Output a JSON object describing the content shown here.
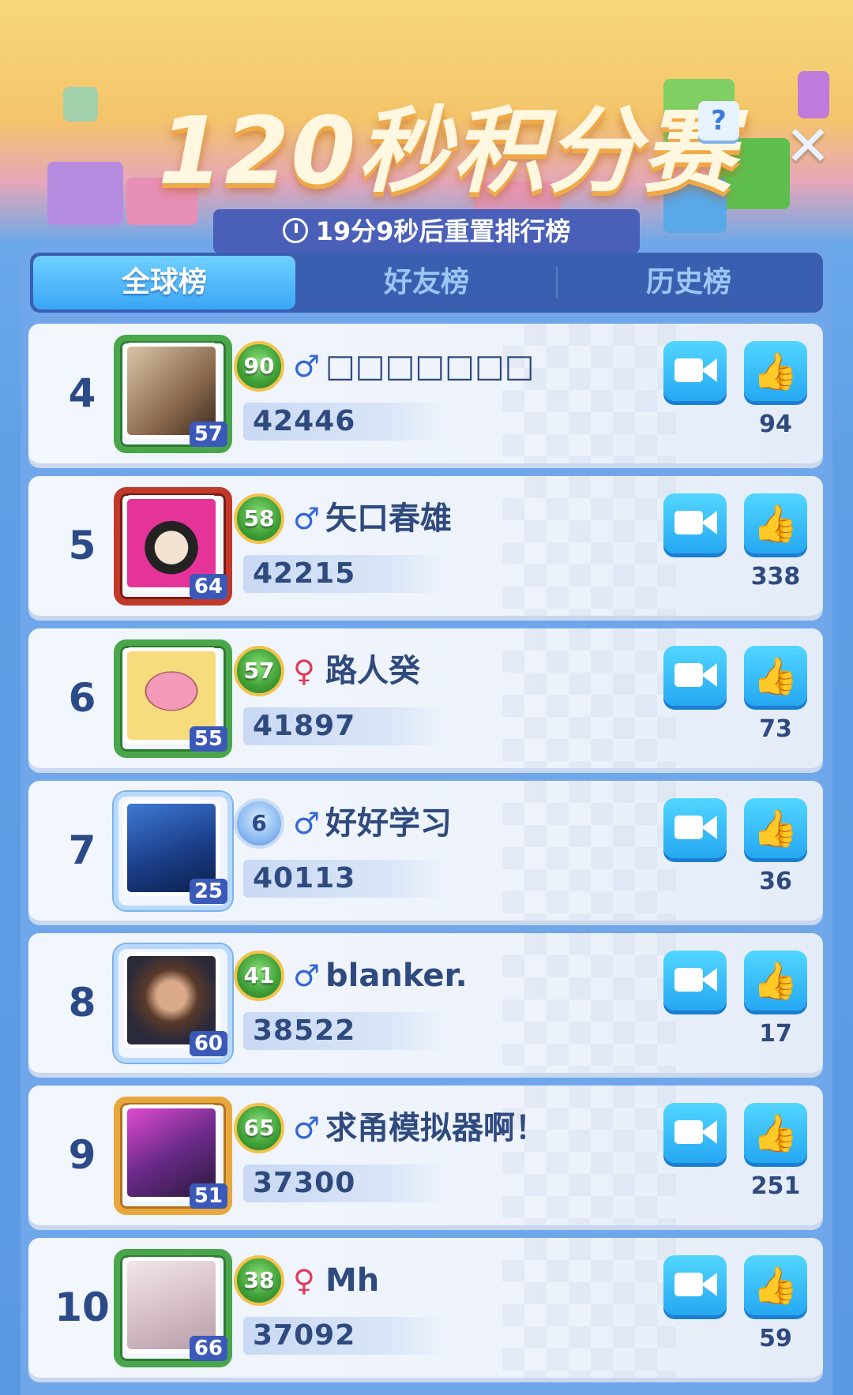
{
  "header": {
    "title": "120秒积分赛",
    "help_label": "?",
    "close_label": "✕",
    "reset_text": "19分9秒后重置排行榜"
  },
  "tabs": [
    {
      "label": "全球榜",
      "active": true
    },
    {
      "label": "好友榜",
      "active": false
    },
    {
      "label": "历史榜",
      "active": false
    }
  ],
  "rows": [
    {
      "rank": "4",
      "level": "90",
      "gender": "♂",
      "name": "□□□□□□□",
      "score": "42446",
      "avatar_level": "57",
      "likes": "94"
    },
    {
      "rank": "5",
      "level": "58",
      "gender": "♂",
      "name": "矢口春雄",
      "score": "42215",
      "avatar_level": "64",
      "likes": "338"
    },
    {
      "rank": "6",
      "level": "57",
      "gender": "♀",
      "name": "路人癸",
      "score": "41897",
      "avatar_level": "55",
      "likes": "73"
    },
    {
      "rank": "7",
      "level": "6",
      "gender": "♂",
      "name": "好好学习",
      "score": "40113",
      "avatar_level": "25",
      "likes": "36"
    },
    {
      "rank": "8",
      "level": "41",
      "gender": "♂",
      "name": "blanker.",
      "score": "38522",
      "avatar_level": "60",
      "likes": "17"
    },
    {
      "rank": "9",
      "level": "65",
      "gender": "♂",
      "name": "求甬模拟器啊！",
      "score": "37300",
      "avatar_level": "51",
      "likes": "251"
    },
    {
      "rank": "10",
      "level": "38",
      "gender": "♀",
      "name": "Mh",
      "score": "37092",
      "avatar_level": "66",
      "likes": "59"
    }
  ],
  "icons": {
    "video": "video-camera-icon",
    "like": "thumbs-up-icon",
    "clock": "clock-icon"
  },
  "colors": {
    "accent": "#25a8f2",
    "tab_active": "#3aa6f5",
    "text_dark": "#2f4a7e",
    "male": "#3568d6",
    "female": "#e23a5a"
  }
}
